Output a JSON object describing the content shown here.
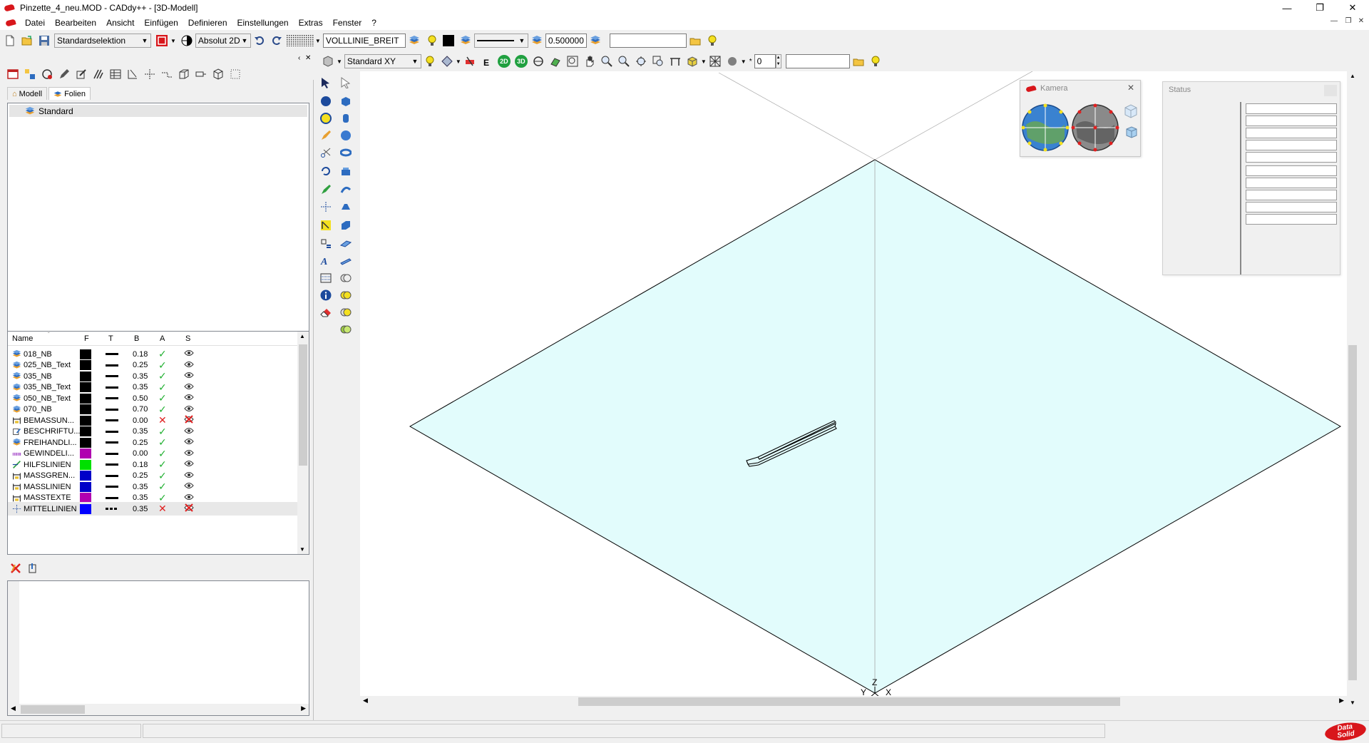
{
  "window": {
    "title": "Pinzette_4_neu.MOD  -  CADdy++ - [3D-Modell]",
    "minimize": "—",
    "restore": "❐",
    "close": "✕"
  },
  "menu": [
    "Datei",
    "Bearbeiten",
    "Ansicht",
    "Einfügen",
    "Definieren",
    "Einstellungen",
    "Extras",
    "Fenster",
    "?"
  ],
  "toolbar1": {
    "selection_mode": "Standardselektion",
    "coord_mode": "Absolut 2D",
    "linetype": "VOLLLINIE_BREIT",
    "line_width": "0.500000",
    "search_value": ""
  },
  "toolbar2": {
    "view": "Standard XY",
    "btn_2d": "2D",
    "btn_3d": "3D",
    "step_value": "0",
    "search_value": ""
  },
  "left_panel": {
    "tabs": [
      {
        "label": "Modell"
      },
      {
        "label": "Folien"
      }
    ],
    "tree": [
      {
        "label": "Standard"
      }
    ],
    "table_headers": {
      "name": "Name",
      "f": "F",
      "t": "T",
      "b": "B",
      "a": "A",
      "s": "S"
    },
    "layers": [
      {
        "name": "018_NB",
        "color": "#000000",
        "width": "0.18",
        "active": true,
        "visible": true,
        "dashed": false,
        "icon": "layer-icon"
      },
      {
        "name": "025_NB_Text",
        "color": "#000000",
        "width": "0.25",
        "active": true,
        "visible": true,
        "dashed": false,
        "icon": "layer-icon"
      },
      {
        "name": "035_NB",
        "color": "#000000",
        "width": "0.35",
        "active": true,
        "visible": true,
        "dashed": false,
        "icon": "layer-icon"
      },
      {
        "name": "035_NB_Text",
        "color": "#000000",
        "width": "0.35",
        "active": true,
        "visible": true,
        "dashed": false,
        "icon": "layer-icon"
      },
      {
        "name": "050_NB_Text",
        "color": "#000000",
        "width": "0.50",
        "active": true,
        "visible": true,
        "dashed": false,
        "icon": "layer-icon"
      },
      {
        "name": "070_NB",
        "color": "#000000",
        "width": "0.70",
        "active": true,
        "visible": true,
        "dashed": false,
        "icon": "layer-icon"
      },
      {
        "name": "BEMASSUN...",
        "color": "#000000",
        "width": "0.00",
        "active": false,
        "visible": false,
        "dashed": false,
        "icon": "dimension-icon"
      },
      {
        "name": "BESCHRIFTU...",
        "color": "#000000",
        "width": "0.35",
        "active": true,
        "visible": true,
        "dashed": false,
        "icon": "text-label-icon"
      },
      {
        "name": "FREIHANDLI...",
        "color": "#000000",
        "width": "0.25",
        "active": true,
        "visible": true,
        "dashed": false,
        "icon": "layer-icon"
      },
      {
        "name": "GEWINDELI...",
        "color": "#b000b0",
        "width": "0.00",
        "active": true,
        "visible": true,
        "dashed": false,
        "icon": "thread-icon"
      },
      {
        "name": "HILFSLINIEN",
        "color": "#00e000",
        "width": "0.18",
        "active": true,
        "visible": true,
        "dashed": false,
        "icon": "helpline-icon"
      },
      {
        "name": "MASSGREN...",
        "color": "#0000c8",
        "width": "0.25",
        "active": true,
        "visible": true,
        "dashed": false,
        "icon": "dimension-icon"
      },
      {
        "name": "MASSLINIEN",
        "color": "#0000c8",
        "width": "0.35",
        "active": true,
        "visible": true,
        "dashed": false,
        "icon": "dimension-icon"
      },
      {
        "name": "MASSTEXTE",
        "color": "#b000b0",
        "width": "0.35",
        "active": true,
        "visible": true,
        "dashed": false,
        "icon": "dimension-icon"
      },
      {
        "name": "MITTELLINIEN",
        "color": "#0000ff",
        "width": "0.35",
        "active": false,
        "visible": false,
        "dashed": true,
        "icon": "centerline-icon"
      }
    ]
  },
  "kamera": {
    "title": "Kamera",
    "close": "✕"
  },
  "status_window": {
    "title": "Status"
  },
  "axis_labels": {
    "y": "Y",
    "z": "Z",
    "x": "X"
  },
  "logo": {
    "line1": "Data",
    "line2": "Solid"
  }
}
